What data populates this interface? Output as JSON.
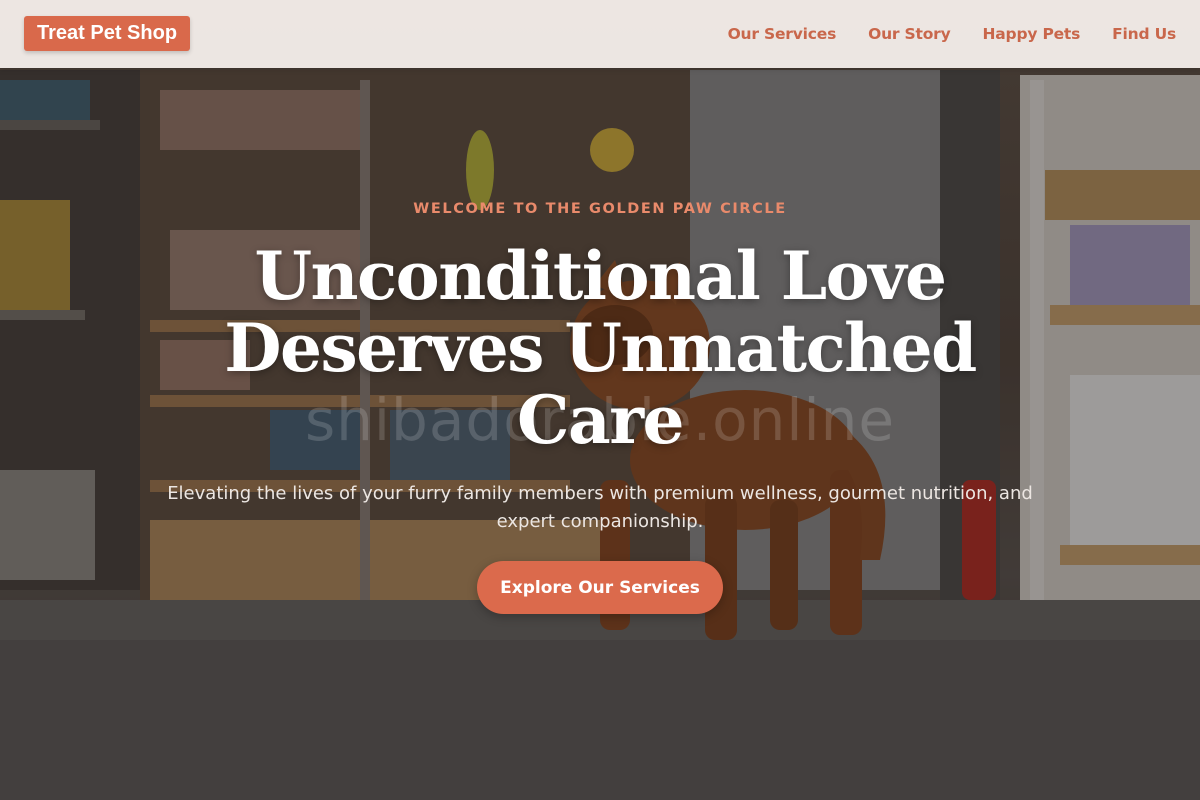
{
  "nav": {
    "brand": "Treat Pet Shop",
    "links": [
      {
        "label": "Our Services"
      },
      {
        "label": "Our Story"
      },
      {
        "label": "Happy Pets"
      },
      {
        "label": "Find Us"
      }
    ]
  },
  "hero": {
    "eyebrow": "WELCOME TO THE GOLDEN PAW CIRCLE",
    "headline": "Unconditional Love Deserves Unmatched Care",
    "watermark": "shibadorable.online",
    "subtitle": "Elevating the lives of your furry family members with premium wellness, gourmet nutrition, and expert companionship.",
    "cta_label": "Explore Our Services"
  },
  "colors": {
    "accent": "#db6a4c",
    "eyebrow": "#e98a6b",
    "nav_background": "#faf3f0",
    "headline": "#ffffff"
  }
}
